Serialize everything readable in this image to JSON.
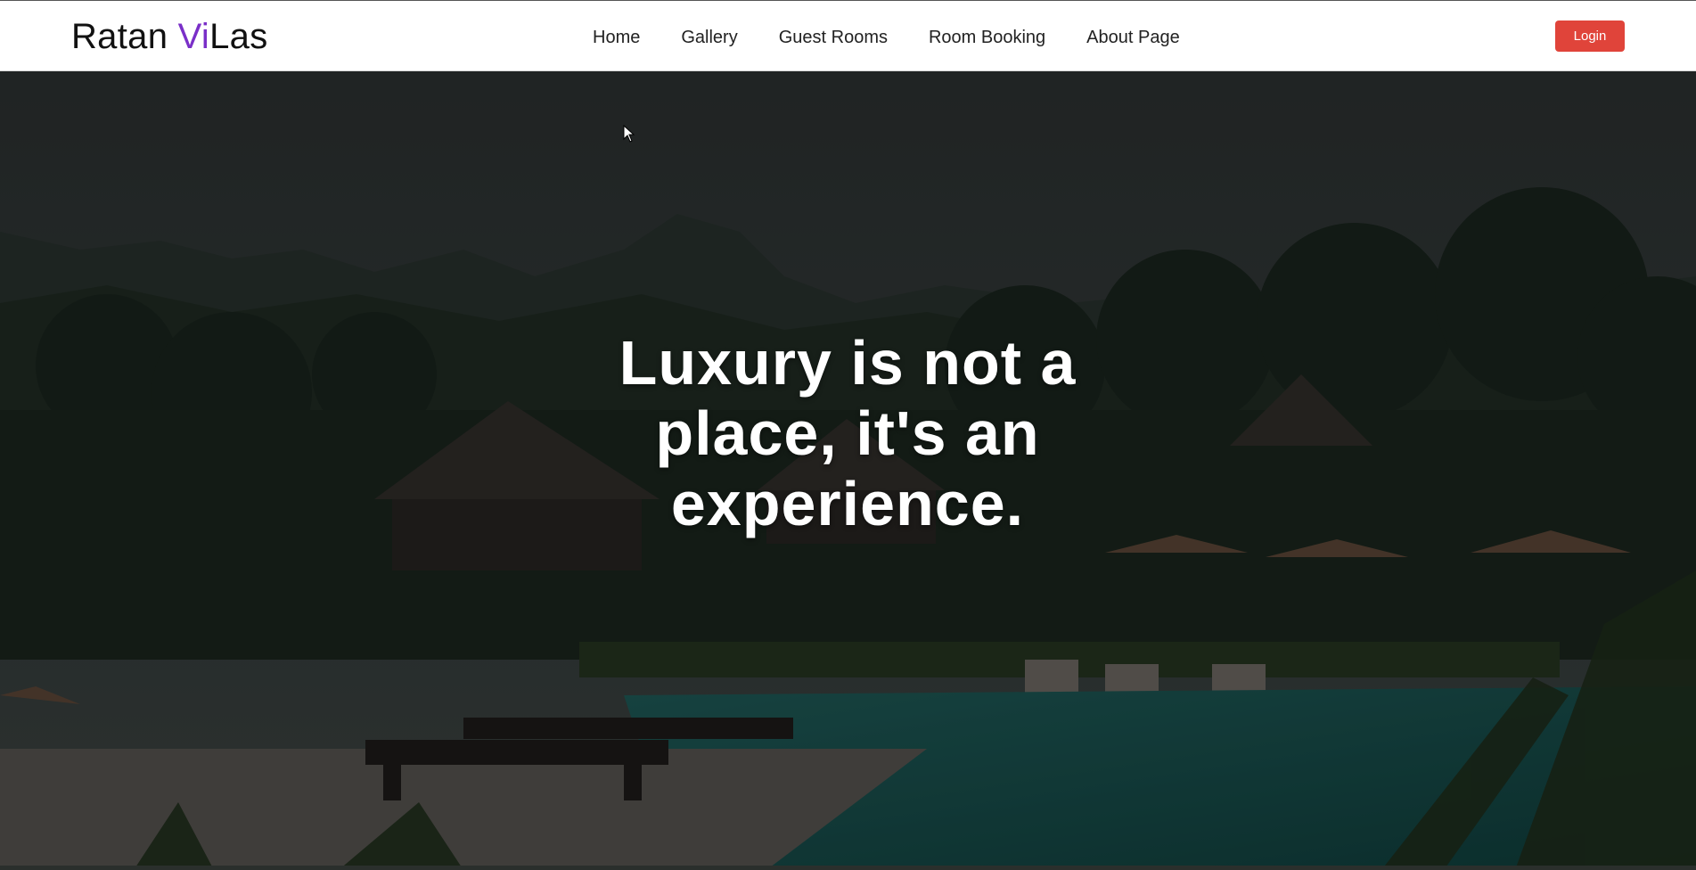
{
  "header": {
    "brand_part1": "Ratan ",
    "brand_accent": "Vi",
    "brand_part2": "Las",
    "nav": [
      {
        "label": "Home"
      },
      {
        "label": "Gallery"
      },
      {
        "label": "Guest Rooms"
      },
      {
        "label": "Room Booking"
      },
      {
        "label": "About Page"
      }
    ],
    "login_label": "Login"
  },
  "hero": {
    "headline": "Luxury is not a place, it's an experience."
  },
  "colors": {
    "brand_accent": "#7a2fc8",
    "login_button": "#e0443a",
    "navbar_bg": "#ffffff"
  },
  "icons": {
    "cursor": "mouse-pointer-icon"
  }
}
